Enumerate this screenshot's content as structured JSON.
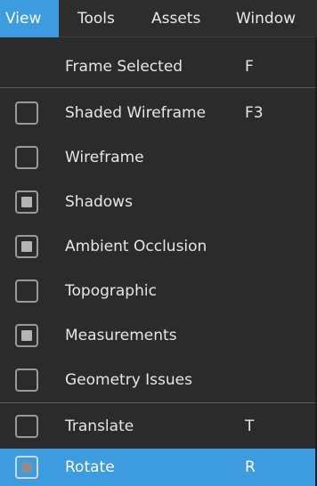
{
  "menubar": {
    "items": [
      {
        "label": "View",
        "active": true
      },
      {
        "label": "Tools"
      },
      {
        "label": "Assets"
      },
      {
        "label": "Window"
      }
    ]
  },
  "view_menu": {
    "items": [
      {
        "label": "Frame Selected",
        "shortcut": "F",
        "checkbox": false
      },
      {
        "label": "Shaded Wireframe",
        "shortcut": "F3",
        "checkbox": true,
        "checked": false
      },
      {
        "label": "Wireframe",
        "shortcut": "",
        "checkbox": true,
        "checked": false
      },
      {
        "label": "Shadows",
        "shortcut": "",
        "checkbox": true,
        "checked": true
      },
      {
        "label": "Ambient Occlusion",
        "shortcut": "",
        "checkbox": true,
        "checked": true
      },
      {
        "label": "Topographic",
        "shortcut": "",
        "checkbox": true,
        "checked": false
      },
      {
        "label": "Measurements",
        "shortcut": "",
        "checkbox": true,
        "checked": true
      },
      {
        "label": "Geometry Issues",
        "shortcut": "",
        "checkbox": true,
        "checked": false
      },
      {
        "label": "Translate",
        "shortcut": "T",
        "checkbox": true,
        "checked": false
      },
      {
        "label": "Rotate",
        "shortcut": "R",
        "checkbox": true,
        "checked": true,
        "highlighted": true
      }
    ]
  },
  "colors": {
    "highlight": "#3d9be0",
    "menu_bg": "#2b2b2b",
    "text": "#e6e6e6"
  }
}
